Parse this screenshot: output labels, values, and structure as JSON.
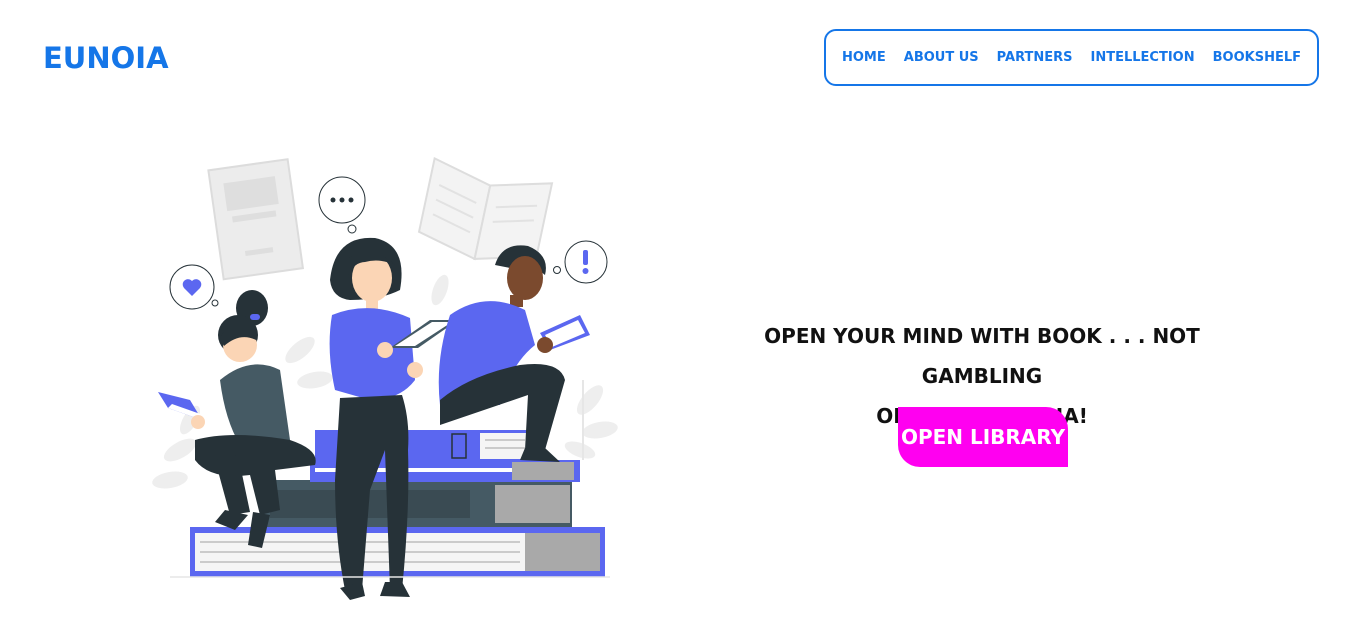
{
  "header": {
    "brand": "EUNOIA",
    "nav": {
      "home": "HOME",
      "about": "ABOUT US",
      "partners": "PARTNERS",
      "intellection": "INTELLECTION",
      "bookshelf": "BOOKSHELF"
    }
  },
  "hero": {
    "tagline_line1": "OPEN YOUR MIND WITH BOOK . . . NOT GAMBLING",
    "tagline_line2": "ON SOCIAL MEDIA!",
    "cta_label": "OPEN LIBRARY",
    "illustration_icons": [
      "heart-icon",
      "ellipsis-icon",
      "exclamation-icon",
      "book-icon"
    ]
  },
  "colors": {
    "brand_blue": "#1576e8",
    "cta_magenta": "#ff00f0",
    "illustration_purple": "#5b67f0",
    "illustration_dark": "#263238"
  }
}
